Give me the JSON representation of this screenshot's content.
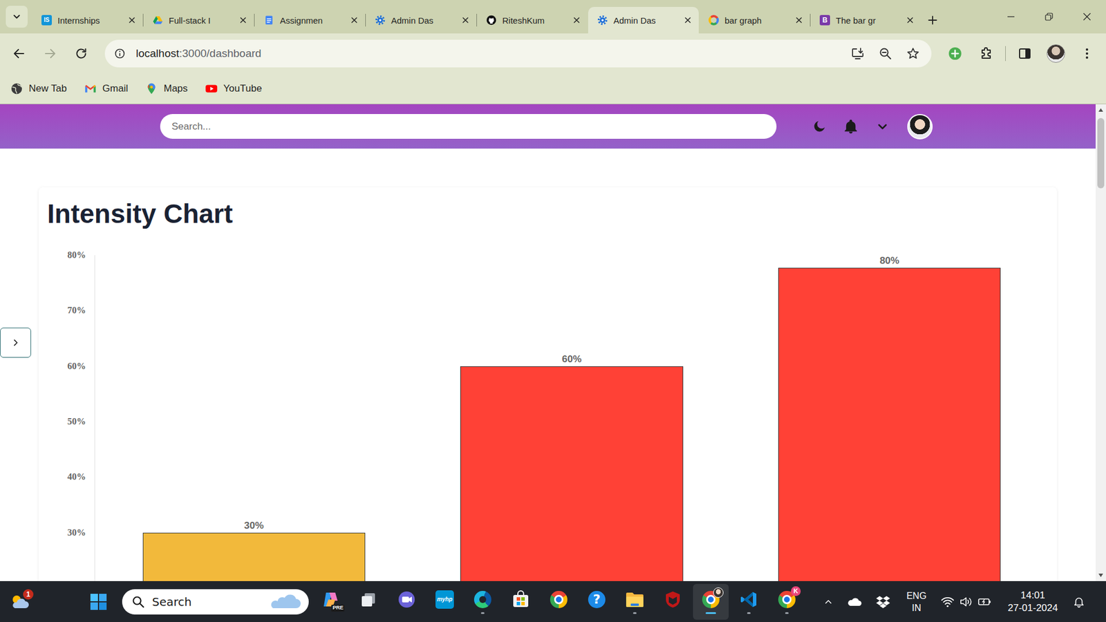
{
  "browser": {
    "tabs": [
      {
        "label": "Internships",
        "kind": "internshala",
        "favicon_text": "IS",
        "selected": false
      },
      {
        "label": "Full-stack I",
        "kind": "drive",
        "selected": false
      },
      {
        "label": "Assignmen",
        "kind": "docs",
        "selected": false
      },
      {
        "label": "Admin Das",
        "kind": "admin",
        "selected": false
      },
      {
        "label": "RiteshKum",
        "kind": "github",
        "selected": false
      },
      {
        "label": "Admin Das",
        "kind": "admin",
        "selected": true
      },
      {
        "label": "bar graph",
        "kind": "google",
        "selected": false
      },
      {
        "label": "The bar gr",
        "kind": "letter",
        "favicon_text": "B",
        "selected": false
      }
    ],
    "forward_disabled": true,
    "address": {
      "host": "localhost",
      "path": ":3000/dashboard"
    },
    "bookmarks": [
      {
        "label": "New Tab",
        "kind": "globe"
      },
      {
        "label": "Gmail",
        "kind": "gmail"
      },
      {
        "label": "Maps",
        "kind": "maps"
      },
      {
        "label": "YouTube",
        "kind": "youtube"
      }
    ]
  },
  "page": {
    "search": {
      "placeholder": "Search..."
    },
    "chart": {
      "title": "Intensity Chart",
      "y_ticks": [
        "80%",
        "70%",
        "60%",
        "50%",
        "40%",
        "30%"
      ],
      "y_max": 80,
      "series": [
        {
          "values": [
            30,
            60,
            80
          ],
          "labels": [
            "30%",
            "60%",
            "80%"
          ],
          "colors": [
            "#f2b93b",
            "#ff4136",
            "#ff4136"
          ]
        }
      ]
    }
  },
  "taskbar": {
    "weather_badge": "1",
    "search": {
      "placeholder": "Search"
    },
    "apps": [
      {
        "kind": "copilot",
        "badge": "PRE",
        "running": false,
        "selected": false
      },
      {
        "kind": "taskview",
        "running": false,
        "selected": false
      },
      {
        "kind": "chat",
        "running": false,
        "selected": false
      },
      {
        "kind": "myhp",
        "text": "myhp",
        "running": false,
        "selected": false
      },
      {
        "kind": "edge",
        "running": true,
        "selected": false
      },
      {
        "kind": "store",
        "running": false,
        "selected": false
      },
      {
        "kind": "chrome",
        "running": false,
        "selected": false
      },
      {
        "kind": "help",
        "text": "?",
        "running": false,
        "selected": false
      },
      {
        "kind": "files",
        "running": true,
        "selected": false
      },
      {
        "kind": "mcafee",
        "running": false,
        "selected": false
      },
      {
        "kind": "chrome-profile",
        "running": true,
        "selected": true
      },
      {
        "kind": "vscode",
        "running": true,
        "selected": false
      },
      {
        "kind": "chrome-badge",
        "badge": "K",
        "running": true,
        "selected": false
      }
    ],
    "tray": {
      "language": "ENG",
      "region": "IN",
      "time": "14:01",
      "date": "27-01-2024"
    }
  }
}
